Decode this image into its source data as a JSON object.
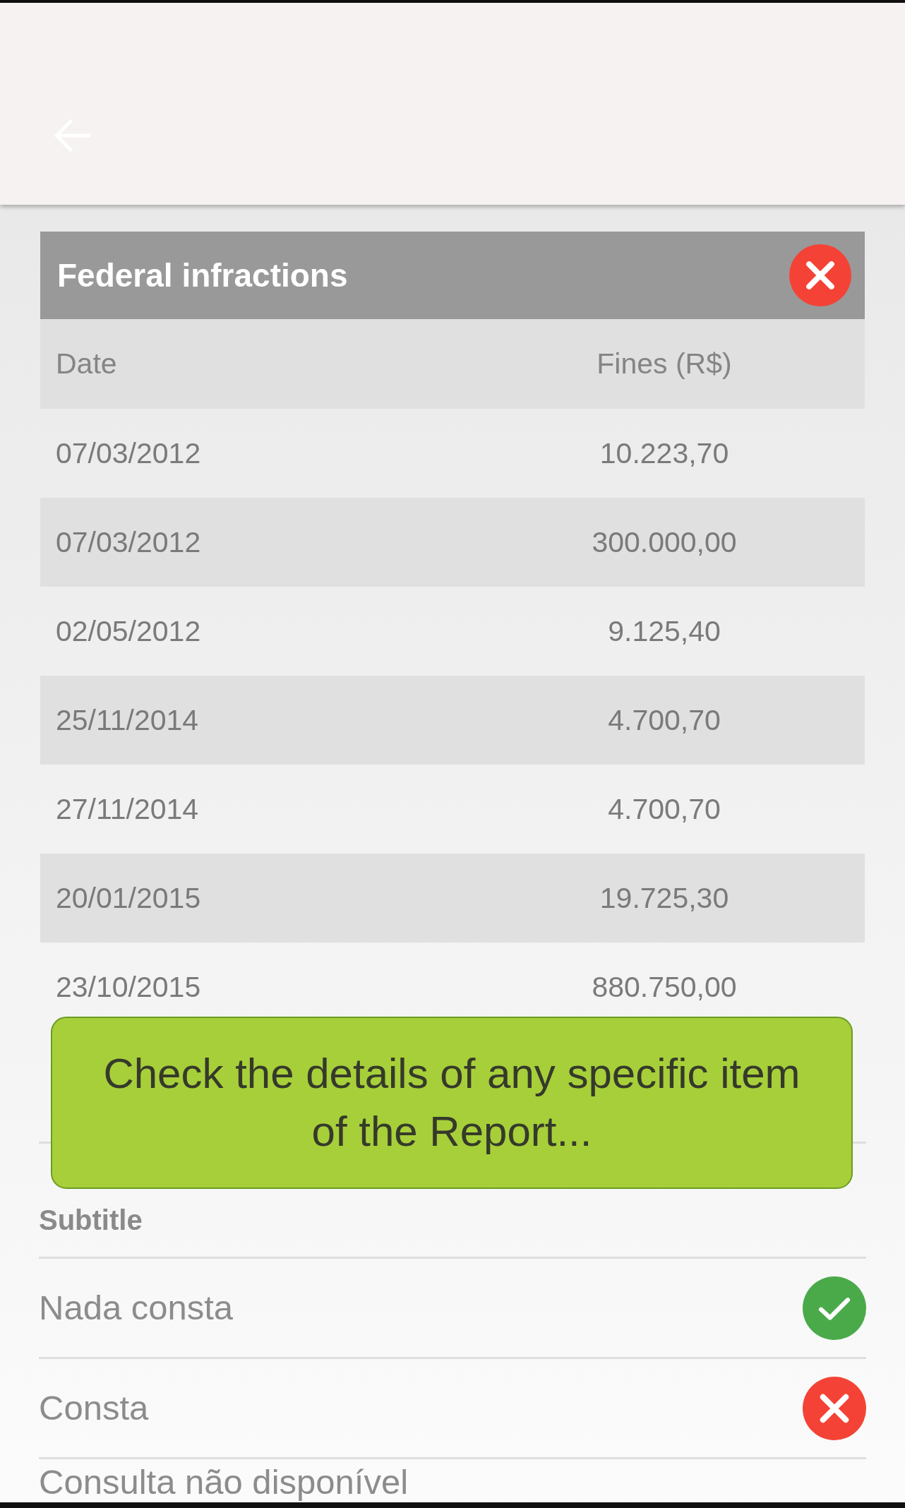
{
  "card": {
    "title": "Federal infractions",
    "flagged": true
  },
  "table": {
    "columns": [
      "Date",
      "Fines (R$)"
    ],
    "rows": [
      {
        "date": "07/03/2012",
        "fine": "10.223,70"
      },
      {
        "date": "07/03/2012",
        "fine": "300.000,00"
      },
      {
        "date": "02/05/2012",
        "fine": "9.125,40"
      },
      {
        "date": "25/11/2014",
        "fine": "4.700,70"
      },
      {
        "date": "27/11/2014",
        "fine": "4.700,70"
      },
      {
        "date": "20/01/2015",
        "fine": "19.725,30"
      },
      {
        "date": "23/10/2015",
        "fine": "880.750,00"
      }
    ]
  },
  "tooltip": {
    "text": "Check the details of any specific item of the Report..."
  },
  "legend": {
    "title": "Subtitle",
    "items": [
      {
        "label": "Nada consta",
        "flagged": false
      },
      {
        "label": "Consta",
        "flagged": true
      },
      {
        "label": "Consulta não disponível"
      }
    ]
  }
}
